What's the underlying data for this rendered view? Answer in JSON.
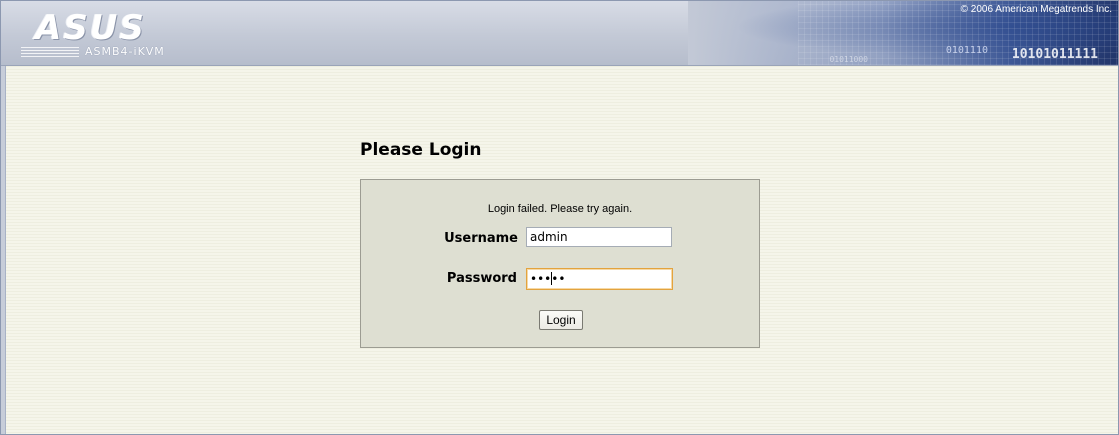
{
  "header": {
    "brand": "ASUS",
    "model": "ASMB4-iKVM",
    "copyright": "© 2006 American Megatrends Inc.",
    "binary_art_1": "0101110",
    "binary_art_2": "10101011111",
    "binary_art_3": "01011000"
  },
  "login": {
    "title": "Please Login",
    "status_message": "Login failed. Please try again.",
    "username_label": "Username",
    "username_value": "admin",
    "password_label": "Password",
    "password_value": "•••••",
    "submit_label": "Login"
  }
}
